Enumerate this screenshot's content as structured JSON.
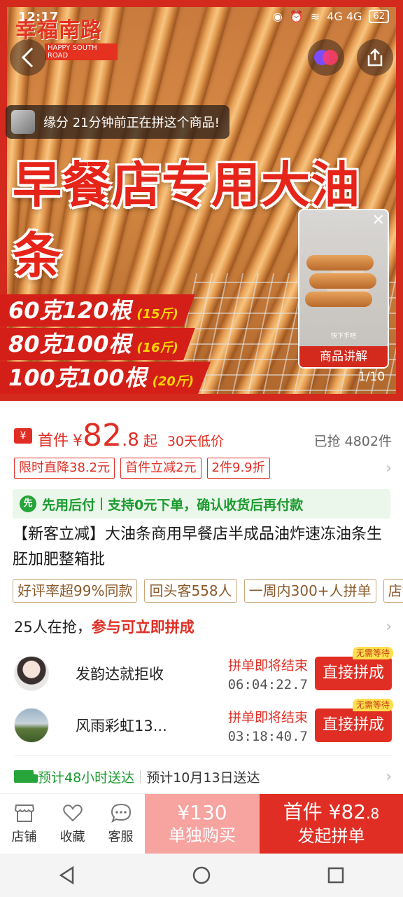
{
  "status_bar": {
    "time": "12:17",
    "battery": "62",
    "network": "4G 4G"
  },
  "hero": {
    "logo_text": "幸福南路",
    "logo_sub": "HAPPY SOUTH ROAD",
    "notification": "缘分 21分钟前正在拼这个商品!",
    "title": "早餐店专用大油条",
    "specs": [
      {
        "main": "60克120根",
        "sub": "(15斤)"
      },
      {
        "main": "80克100根",
        "sub": "(16斤)"
      },
      {
        "main": "100克100根",
        "sub": "(20斤)"
      }
    ],
    "video_caption": "快下手吧",
    "video_label": "商品讲解",
    "counter": "1/10",
    "close_glyph": "✕"
  },
  "price": {
    "tag": "¥",
    "first_label": "首件",
    "currency": "¥",
    "int": "82",
    "dec": ".8",
    "qi": "起",
    "low": "30天低价",
    "sold": "已抢 4802件"
  },
  "coupons": [
    "限时直降38.2元",
    "首件立减2元",
    "2件9.9折"
  ],
  "pay_later": {
    "icon": "先",
    "left": "先用后付",
    "right": "支持0元下单，确认收货后再付款"
  },
  "product_title": "【新客立减】大油条商用早餐店半成品油炸速冻油条生胚加肥整箱批",
  "tags": [
    "好评率超99%同款",
    "回头客558人",
    "一周内300+人拼单",
    "店铺"
  ],
  "group_header": {
    "count": "25人在抢，",
    "join": "参与可立即拼成"
  },
  "groups": [
    {
      "name": "发韵达就拒收",
      "status": "拼单即将结束",
      "time": "06:04:22.7",
      "button": "直接拼成",
      "badge": "无需等待"
    },
    {
      "name": "风雨彩虹13...",
      "status": "拼单即将结束",
      "time": "03:18:40.7",
      "button": "直接拼成",
      "badge": "无需等待"
    }
  ],
  "delivery": {
    "fast": "预计48小时送达",
    "date": "预计10月13日送达"
  },
  "bottom_bar": {
    "shop": "店铺",
    "favorite": "收藏",
    "service": "客服",
    "solo_price": "¥130",
    "solo_label": "单独购买",
    "group_prefix": "首件 ¥",
    "group_price_int": "82",
    "group_price_dec": ".8",
    "group_label": "发起拼单"
  },
  "colors": {
    "accent": "#e02e24",
    "green": "#27a43a",
    "tag_border": "#c9a67a"
  }
}
